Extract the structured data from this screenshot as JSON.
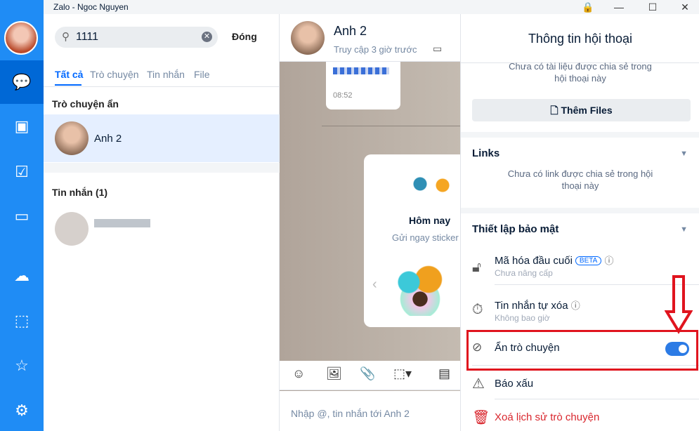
{
  "window": {
    "title": "Zalo - Ngoc Nguyen",
    "lock": "🔒",
    "minimize": "—",
    "maximize": "☐",
    "close": "✕"
  },
  "nav": {
    "items": [
      "chat-icon",
      "contacts-icon",
      "todo-icon",
      "video-icon",
      "cloud-icon",
      "screenshot-icon",
      "star-icon",
      "settings-icon"
    ]
  },
  "search": {
    "value": "1111",
    "close_label": "Đóng",
    "tabs": [
      "Tất cả",
      "Trò chuyện",
      "Tin nhắn",
      "File"
    ],
    "hidden_section": "Trò chuyện ẩn",
    "hidden_item": "Anh 2",
    "messages_section": "Tin nhắn (1)"
  },
  "chat": {
    "name": "Anh 2",
    "status": "Truy cập 3 giờ trước",
    "msg_time": "08:52",
    "card_title": "Hôm nay",
    "card_sub": "Gửi ngay sticker",
    "input_placeholder": "Nhập @, tin nhắn tới Anh 2"
  },
  "info": {
    "title": "Thông tin hội thoại",
    "files_empty": "Chưa có tài liệu được chia sẻ trong hội thoại này",
    "add_files": "Thêm Files",
    "links_title": "Links",
    "links_empty": "Chưa có link được chia sẻ trong hội thoại này",
    "security_title": "Thiết lập bảo mật",
    "e2e": "Mã hóa đầu cuối",
    "beta": "BETA",
    "e2e_sub": "Chưa nâng cấp",
    "auto_delete": "Tin nhắn tự xóa",
    "auto_delete_sub": "Không bao giờ",
    "hide_chat": "Ẩn trò chuyện",
    "hide_chat_on": true,
    "report": "Báo xấu",
    "delete_history": "Xoá lịch sử trò chuyện"
  },
  "colors": {
    "accent": "#0068ff",
    "nav": "#1f8cf5",
    "highlight": "#e0141e",
    "danger": "#d9272e"
  }
}
